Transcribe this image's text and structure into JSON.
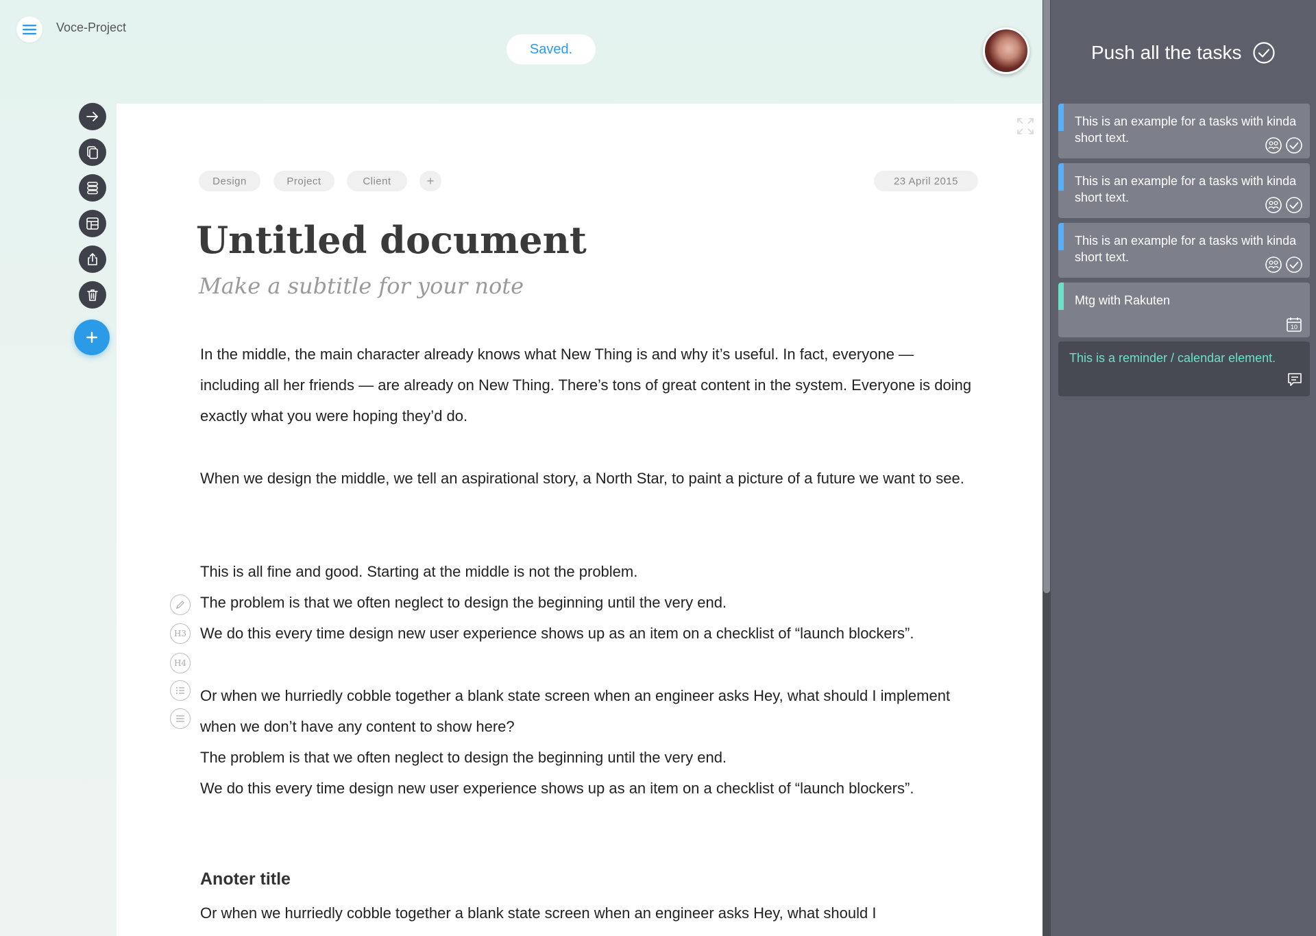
{
  "app": {
    "name": "Voce-Project",
    "save_status": "Saved."
  },
  "tags": [
    "Design",
    "Project",
    "Client"
  ],
  "tag_add_label": "+",
  "date": "23 April 2015",
  "document": {
    "title": "Untitled document",
    "subtitle": "Make a subtitle for your note",
    "paragraphs": [
      "In the middle, the main character already knows what New Thing is and why it’s useful. In fact, everyone — including all her friends — are already on New Thing. There’s tons of great content in the system. Everyone is doing exactly what you were hoping they’d do.",
      "When we design the middle, we tell an aspirational story, a North Star, to paint a picture of a future we want to see.",
      "This is all fine and good. Starting at the middle is not the problem.",
      "The problem is that we often neglect to design the beginning until the very end.",
      "We do this every time design new user experience shows up as an item on a checklist of “launch blockers”.",
      "Or when we hurriedly cobble together a blank state screen when an engineer asks Hey, what should I implement when we don’t have any content to show here?",
      "The problem is that we often neglect to design the beginning until the very end.",
      "We do this every time design new user experience shows up as an item on a checklist of “launch blockers”.",
      "Or when we hurriedly cobble together a blank state screen when an engineer asks Hey, what should I"
    ],
    "heading2": "Anoter title"
  },
  "format_tools": {
    "h3": "H3",
    "h4": "H4"
  },
  "panel": {
    "title": "Push all the tasks",
    "tasks": [
      {
        "text": "This is an example for a tasks with kinda short text.",
        "color": "#5aaef5"
      },
      {
        "text": "This is an example for a tasks with kinda short text.",
        "color": "#5aaef5"
      },
      {
        "text": "This is an example for a tasks with kinda short text.",
        "color": "#5aaef5"
      },
      {
        "text": "Mtg with Rakuten",
        "color": "#6ee0c8"
      }
    ],
    "calendar_day": "10",
    "reminder": "This is a reminder / calendar element."
  },
  "colors": {
    "accent": "#2b9be8",
    "panel": "#5d5f6a",
    "teal": "#6ee0c8"
  },
  "icons": [
    "menu-icon",
    "arrow-right-icon",
    "copy-icon",
    "stack-icon",
    "layout-icon",
    "share-icon",
    "trash-icon",
    "plus-icon",
    "expand-icon",
    "pencil-icon",
    "list-icon",
    "align-icon",
    "check-circle-icon",
    "group-icon",
    "calendar-icon",
    "chat-icon"
  ]
}
